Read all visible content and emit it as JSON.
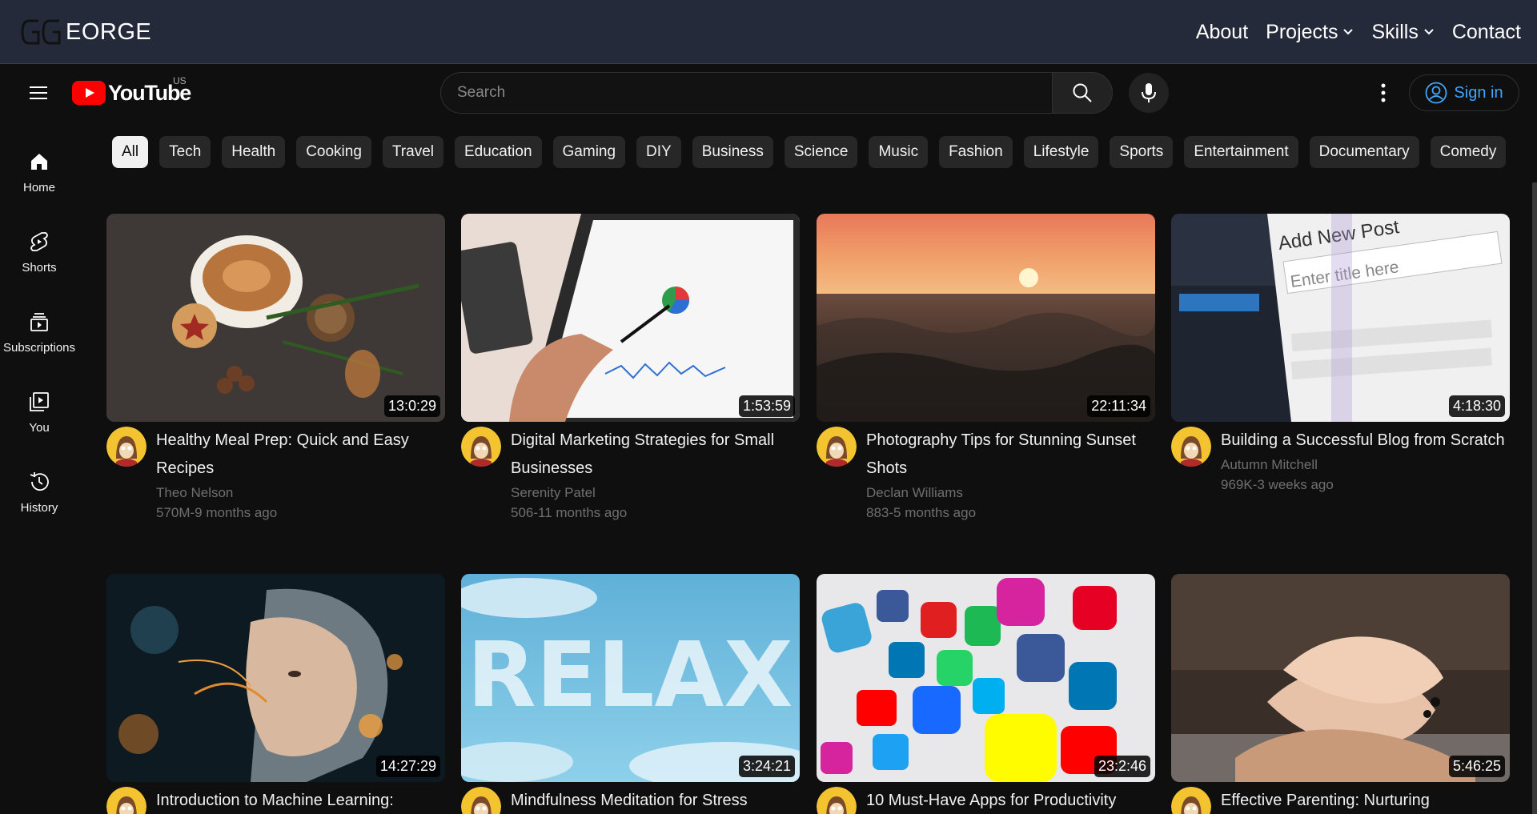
{
  "portfolio_nav": {
    "brand": "EORGE",
    "items": [
      {
        "label": "About"
      },
      {
        "label": "Projects"
      },
      {
        "label": "Skills"
      },
      {
        "label": "Contact"
      }
    ]
  },
  "header": {
    "logo_text": "YouTube",
    "country": "US",
    "search_placeholder": "Search",
    "signin_label": "Sign in"
  },
  "sidebar": {
    "items": [
      {
        "label": "Home",
        "icon": "home-icon"
      },
      {
        "label": "Shorts",
        "icon": "shorts-icon"
      },
      {
        "label": "Subscriptions",
        "icon": "subscriptions-icon"
      },
      {
        "label": "You",
        "icon": "you-icon"
      },
      {
        "label": "History",
        "icon": "history-icon"
      }
    ]
  },
  "chips": [
    "All",
    "Tech",
    "Health",
    "Cooking",
    "Travel",
    "Education",
    "Gaming",
    "DIY",
    "Business",
    "Science",
    "Music",
    "Fashion",
    "Lifestyle",
    "Sports",
    "Entertainment",
    "Documentary",
    "Comedy"
  ],
  "videos": [
    {
      "title": "Healthy Meal Prep: Quick and Easy Recipes",
      "channel": "Theo Nelson",
      "stats": "570M-9 months ago",
      "duration": "13:0:29"
    },
    {
      "title": "Digital Marketing Strategies for Small Businesses",
      "channel": "Serenity Patel",
      "stats": "506-11 months ago",
      "duration": "1:53:59"
    },
    {
      "title": "Photography Tips for Stunning Sunset Shots",
      "channel": "Declan Williams",
      "stats": "883-5 months ago",
      "duration": "22:11:34"
    },
    {
      "title": "Building a Successful Blog from Scratch",
      "channel": "Autumn Mitchell",
      "stats": "969K-3 weeks ago",
      "duration": "4:18:30"
    },
    {
      "title": "Introduction to Machine Learning:",
      "channel": "",
      "stats": "",
      "duration": "14:27:29"
    },
    {
      "title": "Mindfulness Meditation for Stress",
      "channel": "",
      "stats": "",
      "duration": "3:24:21"
    },
    {
      "title": "10 Must-Have Apps for Productivity",
      "channel": "",
      "stats": "",
      "duration": "23:2:46"
    },
    {
      "title": "Effective Parenting: Nurturing",
      "channel": "",
      "stats": "",
      "duration": "5:46:25"
    }
  ],
  "thumb_text": {
    "relax": "RELAX",
    "add_new_post": "Add New Post",
    "enter_title": "Enter title here"
  },
  "colors": {
    "accent_link": "#3ea6ff",
    "yt_red": "#ff0000",
    "topbar_bg": "#252a3b"
  }
}
